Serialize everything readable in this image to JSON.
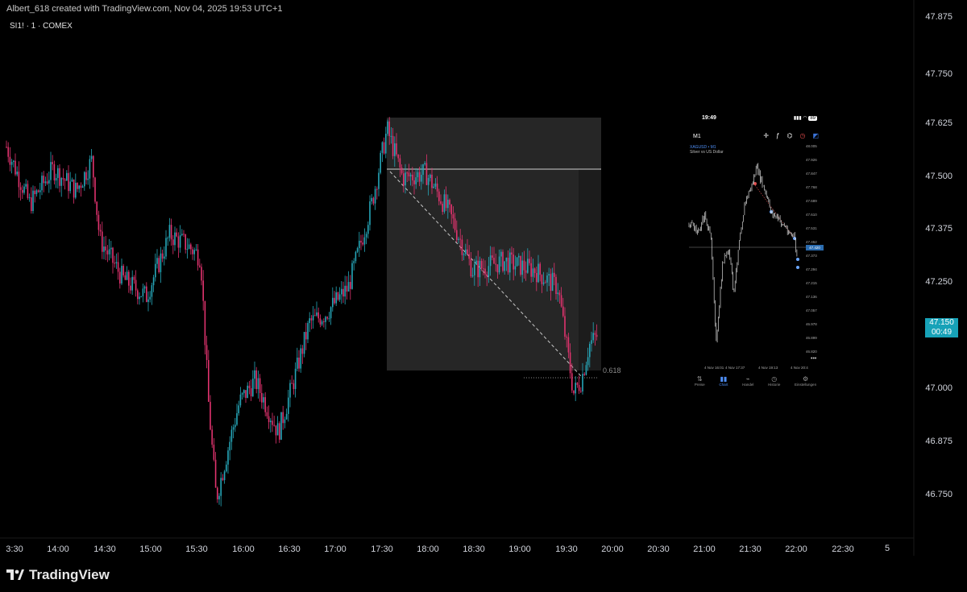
{
  "header": {
    "attribution": "Albert_618 created with TradingView.com, Nov 04, 2025 19:53 UTC+1",
    "symbol_line": "SI1! · 1 · COMEX"
  },
  "price_axis": {
    "labels": [
      "47.875",
      "47.750",
      "47.625",
      "47.500",
      "47.375",
      "47.250",
      "47.000",
      "46.875",
      "46.750"
    ]
  },
  "current_price": {
    "price": "47.150",
    "countdown": "00:49"
  },
  "time_axis": {
    "labels": [
      "3:30",
      "14:00",
      "14:30",
      "15:00",
      "15:30",
      "16:00",
      "16:30",
      "17:00",
      "17:30",
      "18:00",
      "18:30",
      "19:00",
      "19:30",
      "20:00",
      "20:30",
      "21:00",
      "21:30",
      "22:00",
      "22:30"
    ],
    "future_label": "5"
  },
  "fib_label": "0.618",
  "brand": {
    "name": "TradingView"
  },
  "colors": {
    "up": "#26a6b8",
    "down": "#e0336e",
    "price_tag": "#17a2b8",
    "background": "#000000"
  },
  "phone": {
    "time": "19:49",
    "battery": "89",
    "timeframe": "M1",
    "symbol": "XAGUSD • M1",
    "description": "Silver vs US Dollar",
    "price_labels": [
      "48.005",
      "47.926",
      "47.847",
      "47.768",
      "47.689",
      "47.610",
      "47.531",
      "47.452",
      "47.373",
      "47.294",
      "47.215",
      "47.136",
      "47.057",
      "46.978",
      "46.899",
      "46.820"
    ],
    "last_price": "47.420",
    "time_labels": [
      "4 Nov 16:01",
      "4 Nov 17:37",
      "4 Nov 19:13",
      "4 Nov 20:4"
    ],
    "nav": [
      {
        "label": "Preise",
        "icon": "arrows-icon"
      },
      {
        "label": "Chart",
        "icon": "candles-icon"
      },
      {
        "label": "Handel",
        "icon": "trade-icon"
      },
      {
        "label": "Historie",
        "icon": "clock-icon"
      },
      {
        "label": "Einstellungen",
        "icon": "gear-icon"
      }
    ]
  },
  "chart_data": {
    "type": "candlestick",
    "symbol": "SI1!",
    "exchange": "COMEX",
    "timeframe": "1",
    "x_range": [
      "13:30",
      "20:00"
    ],
    "ylim": [
      46.7,
      47.89
    ],
    "close_path": [
      [
        "13:30",
        47.58
      ],
      [
        "13:45",
        47.45
      ],
      [
        "14:00",
        47.53
      ],
      [
        "14:15",
        47.48
      ],
      [
        "14:25",
        47.55
      ],
      [
        "14:30",
        47.37
      ],
      [
        "14:45",
        47.28
      ],
      [
        "15:00",
        47.24
      ],
      [
        "15:15",
        47.38
      ],
      [
        "15:25",
        47.36
      ],
      [
        "15:35",
        47.33
      ],
      [
        "15:40",
        47.0
      ],
      [
        "15:45",
        46.78
      ],
      [
        "15:55",
        46.93
      ],
      [
        "16:00",
        47.0
      ],
      [
        "16:10",
        47.05
      ],
      [
        "16:25",
        46.93
      ],
      [
        "16:35",
        47.05
      ],
      [
        "16:45",
        47.18
      ],
      [
        "16:55",
        47.2
      ],
      [
        "17:10",
        47.26
      ],
      [
        "17:25",
        47.45
      ],
      [
        "17:35",
        47.62
      ],
      [
        "17:45",
        47.51
      ],
      [
        "18:00",
        47.52
      ],
      [
        "18:15",
        47.43
      ],
      [
        "18:30",
        47.3
      ],
      [
        "18:50",
        47.32
      ],
      [
        "19:10",
        47.3
      ],
      [
        "19:25",
        47.26
      ],
      [
        "19:35",
        47.02
      ],
      [
        "19:40",
        47.05
      ],
      [
        "19:45",
        47.13
      ],
      [
        "19:50",
        47.15
      ]
    ],
    "levels": [
      {
        "type": "horizontal",
        "price": 47.51
      },
      {
        "type": "fib",
        "label": "0.618",
        "price": 47.03
      }
    ],
    "current_price": 47.15
  }
}
